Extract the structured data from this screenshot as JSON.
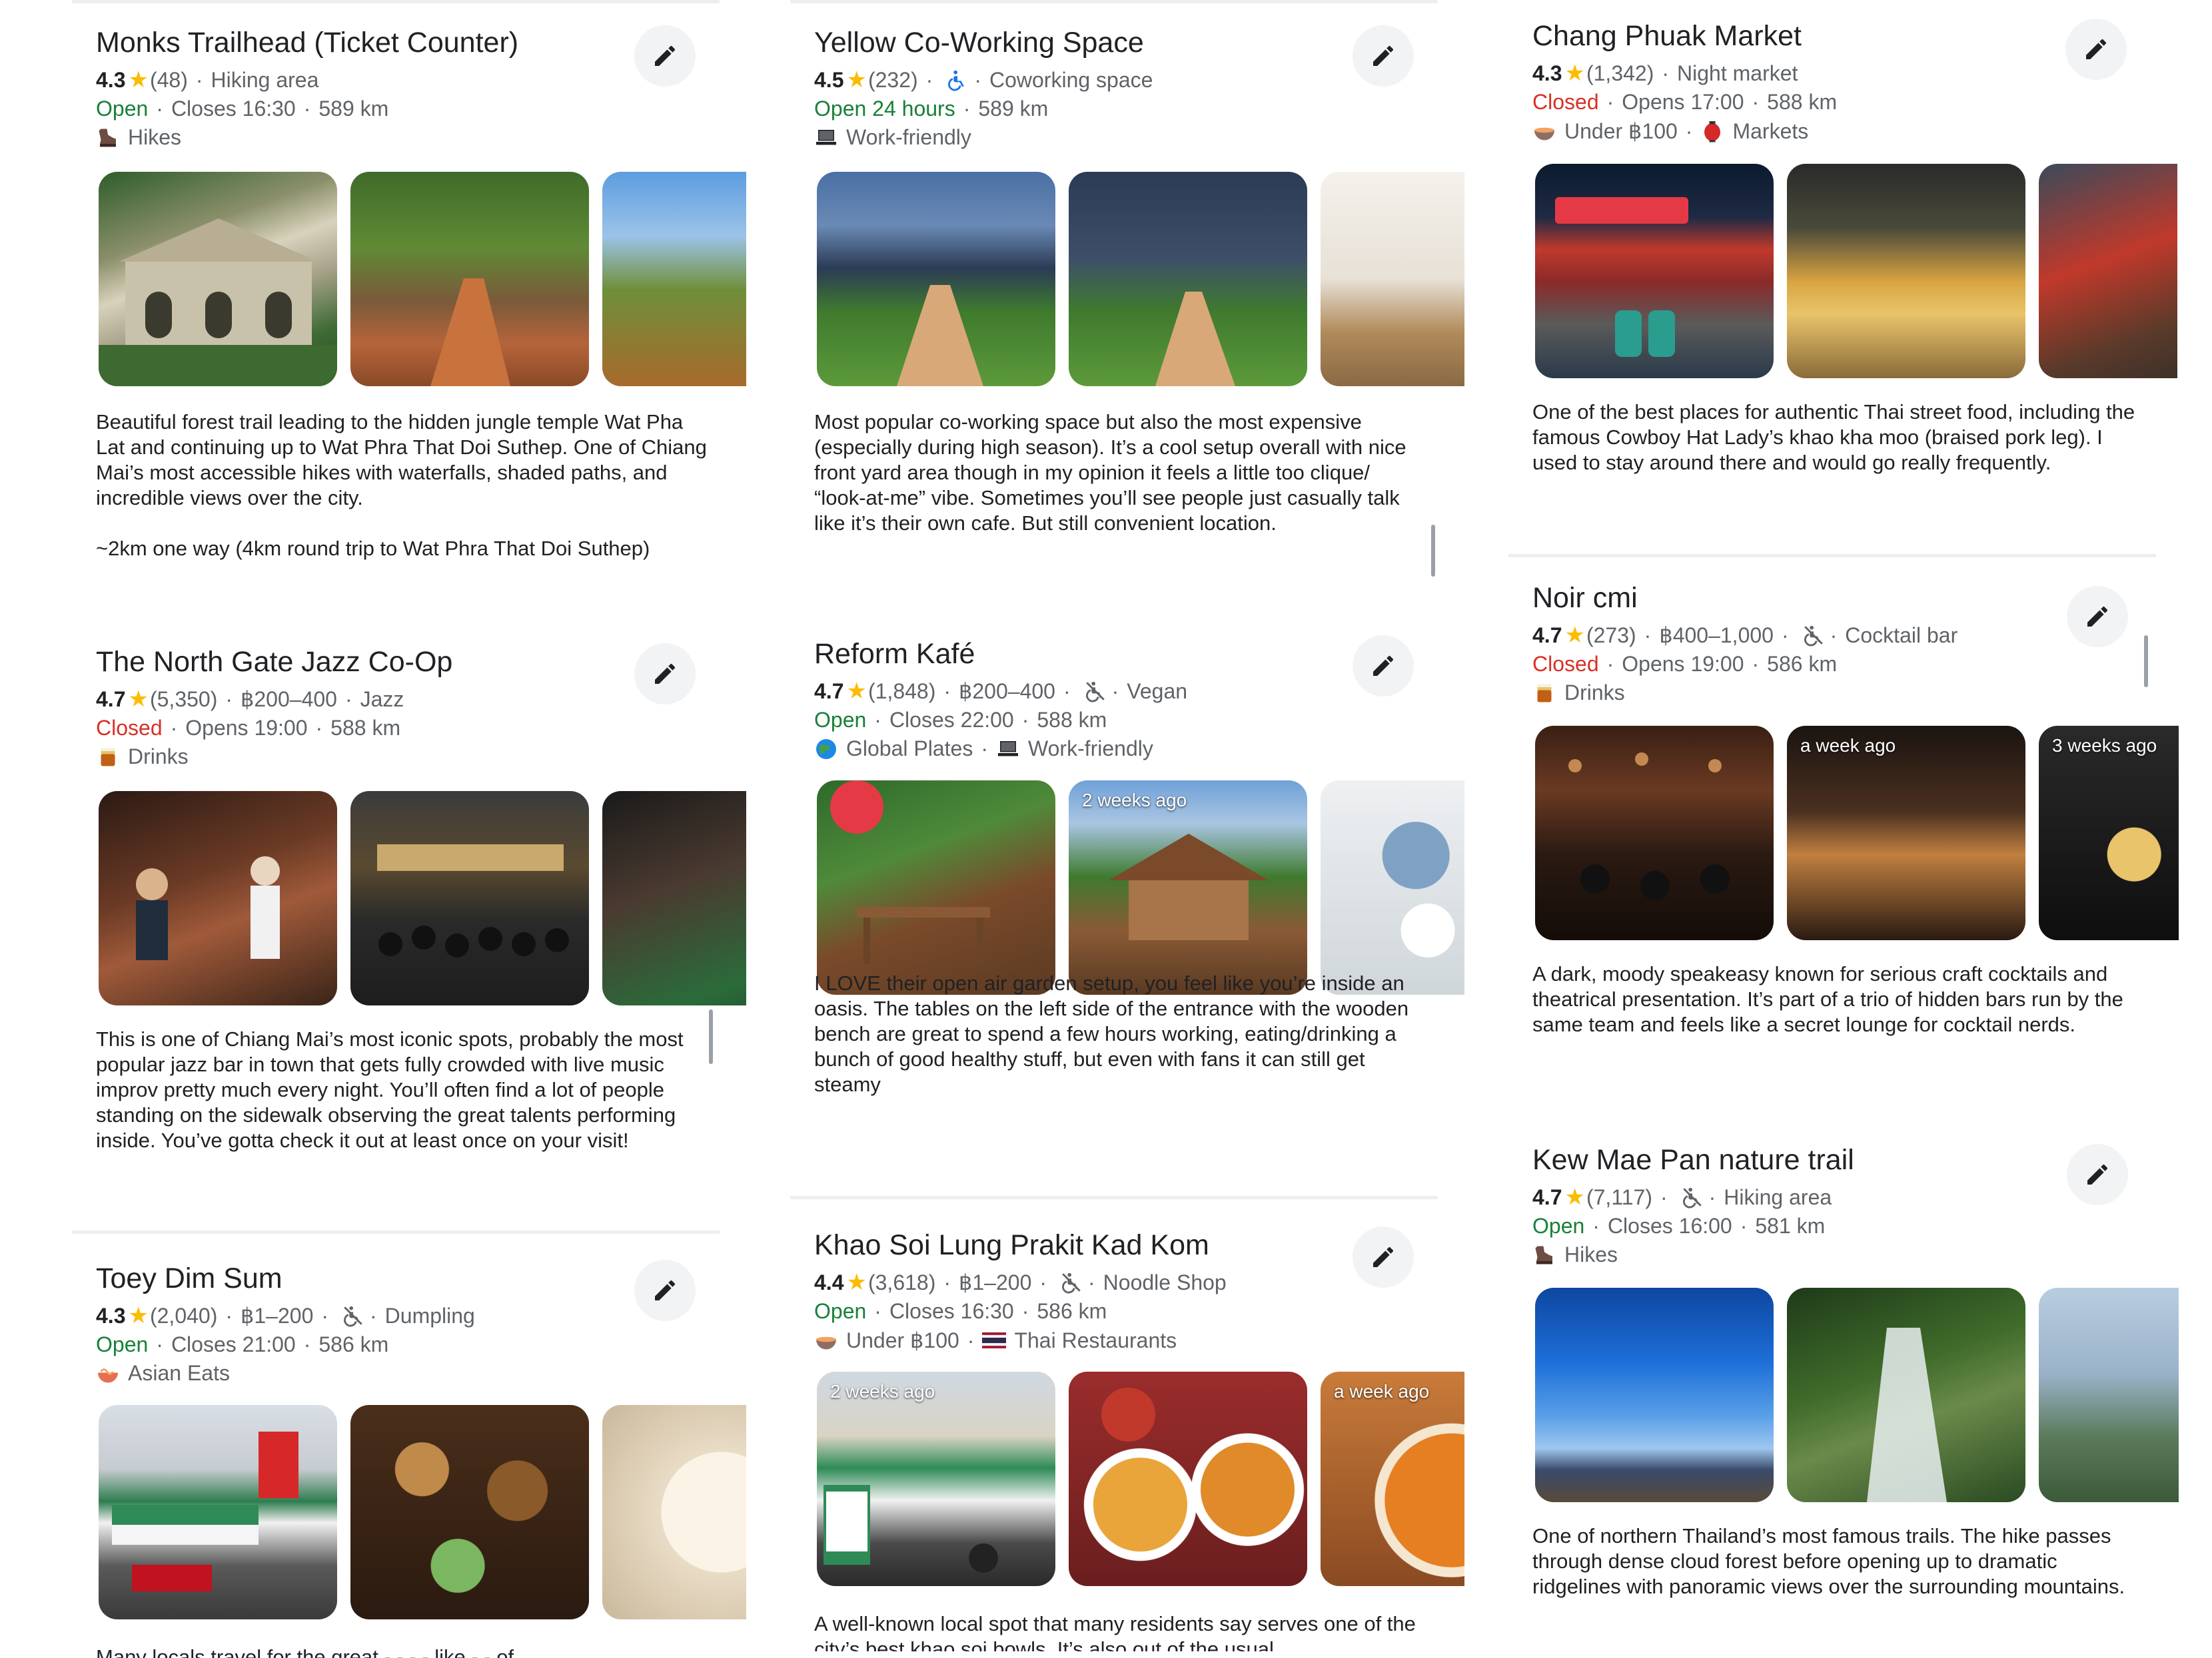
{
  "accent": {
    "open": "#188038",
    "closed": "#d93025",
    "star": "#fbbc04"
  },
  "columns": [
    {
      "cards": [
        {
          "title": "Monks Trailhead (Ticket Counter)",
          "rating": "4.3",
          "reviews": "(48)",
          "category": "Hiking area",
          "status": "Open",
          "status_type": "open",
          "hours": "Closes 16:30",
          "distance": "589 km",
          "tags": [
            {
              "icon": "hiking-boot-icon",
              "label": "Hikes"
            }
          ],
          "photos": [
            {
              "label": ""
            },
            {
              "label": ""
            },
            {
              "label": ""
            }
          ],
          "description": [
            "Beautiful forest trail leading to the hidden jungle temple Wat Pha Lat and continuing up to Wat Phra That Doi Suthep. One of Chiang Mai’s most accessible hikes with waterfalls, shaded paths, and incredible views over the city.",
            "~2km one way (4km round trip to Wat Phra That Doi Suthep)"
          ]
        },
        {
          "title": "The North Gate Jazz Co-Op",
          "rating": "4.7",
          "reviews": "(5,350)",
          "price": "฿200–400",
          "category": "Jazz",
          "status": "Closed",
          "status_type": "closed",
          "hours": "Opens 19:00",
          "distance": "588 km",
          "tags": [
            {
              "icon": "drink-glass-icon",
              "label": "Drinks"
            }
          ],
          "photos": [
            {
              "label": ""
            },
            {
              "label": ""
            },
            {
              "label": ""
            }
          ],
          "description": [
            "This is one of Chiang Mai’s most iconic spots, probably the most popular jazz bar in town that gets fully crowded with live music improv pretty much every night. You’ll often find a lot of people standing on the sidewalk observing the great talents performing inside. You’ve gotta check it out at least once on your visit!"
          ]
        },
        {
          "title": "Toey Dim Sum",
          "rating": "4.3",
          "reviews": "(2,040)",
          "price": "฿1–200",
          "category": "Dumpling",
          "status": "Open",
          "status_type": "open",
          "hours": "Closes 21:00",
          "distance": "586 km",
          "tags": [
            {
              "icon": "noodle-bowl-icon",
              "label": "Asian Eats"
            }
          ],
          "photos": [
            {
              "label": ""
            },
            {
              "label": ""
            },
            {
              "label": ""
            }
          ],
          "description": [
            "Many locals travel for the great  -  -  -  -  like  -  -  of"
          ]
        }
      ]
    },
    {
      "cards": [
        {
          "title": "Yellow Co-Working Space",
          "rating": "4.5",
          "reviews": "(232)",
          "category": "Coworking space",
          "status": "Open 24 hours",
          "status_type": "open",
          "hours": "",
          "distance": "589 km",
          "tags": [
            {
              "icon": "laptop-icon",
              "label": "Work-friendly"
            }
          ],
          "photos": [
            {
              "label": ""
            },
            {
              "label": ""
            },
            {
              "label": ""
            }
          ],
          "description": [
            "Most popular co-working space but also the most expensive (especially during high season). It’s a cool setup overall with nice front yard area though in my opinion it feels a little too clique/ “look-at-me” vibe. Sometimes you’ll see people just casually talk like it’s their own cafe. But still convenient location."
          ]
        },
        {
          "title": "Reform Kafé",
          "rating": "4.7",
          "reviews": "(1,848)",
          "price": "฿200–400",
          "category": "Vegan",
          "status": "Open",
          "status_type": "open",
          "hours": "Closes 22:00",
          "distance": "588 km",
          "tags": [
            {
              "icon": "globe-icon",
              "label": "Global Plates"
            },
            {
              "icon": "laptop-icon",
              "label": "Work-friendly"
            }
          ],
          "photos": [
            {
              "label": ""
            },
            {
              "label": "2 weeks ago"
            },
            {
              "label": ""
            }
          ],
          "description": [
            "I LOVE their open air garden setup, you feel like you’re inside an oasis. The tables on the left side of the entrance with the wooden bench are great to spend a few hours working, eating/drinking a bunch of good healthy stuff, but even with fans it can still get steamy"
          ]
        },
        {
          "title": "Khao Soi Lung Prakit Kad Kom",
          "rating": "4.4",
          "reviews": "(3,618)",
          "price": "฿1–200",
          "category": "Noodle Shop",
          "status": "Open",
          "status_type": "open",
          "hours": "Closes 16:30",
          "distance": "586 km",
          "tags": [
            {
              "icon": "bowl-icon",
              "label": "Under ฿100"
            },
            {
              "icon": "thai-flag-icon",
              "label": "Thai Restaurants"
            }
          ],
          "photos": [
            {
              "label": "2 weeks ago"
            },
            {
              "label": ""
            },
            {
              "label": "a week ago"
            }
          ],
          "description": [
            "A well-known local spot that many residents say serves one of the city’s best khao soi bowls. It’s also out of the usual"
          ]
        }
      ]
    },
    {
      "cards": [
        {
          "title": "Chang Phuak Market",
          "rating": "4.3",
          "reviews": "(1,342)",
          "category": "Night market",
          "status": "Closed",
          "status_type": "closed",
          "hours": "Opens 17:00",
          "distance": "588 km",
          "tags": [
            {
              "icon": "bowl-icon",
              "label": "Under ฿100"
            },
            {
              "icon": "lantern-icon",
              "label": "Markets"
            }
          ],
          "photos": [
            {
              "label": ""
            },
            {
              "label": ""
            },
            {
              "label": ""
            }
          ],
          "description": [
            "One of the best places for authentic Thai street food, including the famous Cowboy Hat Lady’s khao kha moo (braised pork leg). I used to stay around there and would go really frequently."
          ]
        },
        {
          "title": "Noir cmi",
          "rating": "4.7",
          "reviews": "(273)",
          "price": "฿400–1,000",
          "category": "Cocktail bar",
          "status": "Closed",
          "status_type": "closed",
          "hours": "Opens 19:00",
          "distance": "586 km",
          "tags": [
            {
              "icon": "drink-glass-icon",
              "label": "Drinks"
            }
          ],
          "photos": [
            {
              "label": ""
            },
            {
              "label": "a week ago"
            },
            {
              "label": "3 weeks ago"
            }
          ],
          "description": [
            "A dark, moody speakeasy known for serious craft cocktails and theatrical presentation. It’s part of a trio of hidden bars run by the same team and feels like a secret lounge for cocktail nerds."
          ]
        },
        {
          "title": "Kew Mae Pan nature trail",
          "rating": "4.7",
          "reviews": "(7,117)",
          "category": "Hiking area",
          "status": "Open",
          "status_type": "open",
          "hours": "Closes 16:00",
          "distance": "581 km",
          "tags": [
            {
              "icon": "hiking-boot-icon",
              "label": "Hikes"
            }
          ],
          "photos": [
            {
              "label": ""
            },
            {
              "label": ""
            },
            {
              "label": ""
            }
          ],
          "description": [
            "One of northern Thailand’s most famous trails. The hike passes through dense cloud forest before opening up to dramatic ridgelines with panoramic views over the surrounding mountains."
          ]
        }
      ]
    }
  ]
}
